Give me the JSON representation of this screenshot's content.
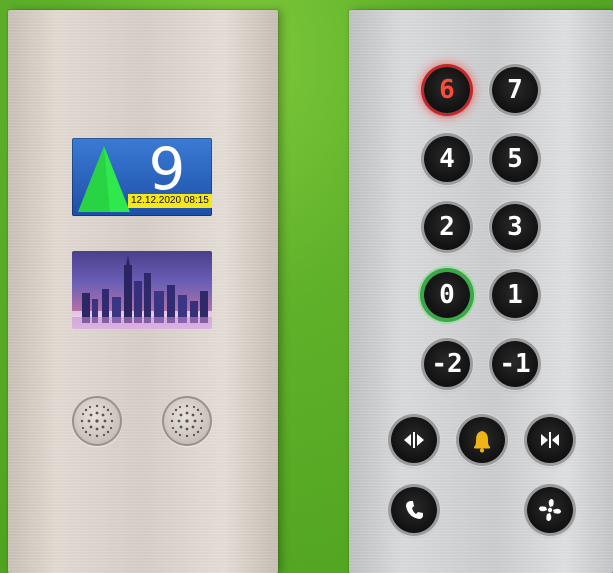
{
  "indicator": {
    "floor": "9",
    "datetime": "12.12.2020 08:15",
    "direction": "up",
    "arrow_color": "#2ee84c"
  },
  "floor_buttons": [
    {
      "label": "6",
      "state": "selected"
    },
    {
      "label": "7"
    },
    {
      "label": "4"
    },
    {
      "label": "5"
    },
    {
      "label": "2"
    },
    {
      "label": "3"
    },
    {
      "label": "0",
      "state": "main-floor"
    },
    {
      "label": "1"
    },
    {
      "label": "-2"
    },
    {
      "label": "-1"
    }
  ],
  "control_buttons": {
    "door_open": "door-open-icon",
    "alarm": "alarm-bell-icon",
    "door_close": "door-close-icon",
    "phone": "phone-icon",
    "fan": "fan-icon"
  },
  "colors": {
    "background": "#5fb12a",
    "selected_floor": "#ff4b3a",
    "main_floor_ring": "#3aa84a",
    "alarm_icon": "#f0b419"
  }
}
